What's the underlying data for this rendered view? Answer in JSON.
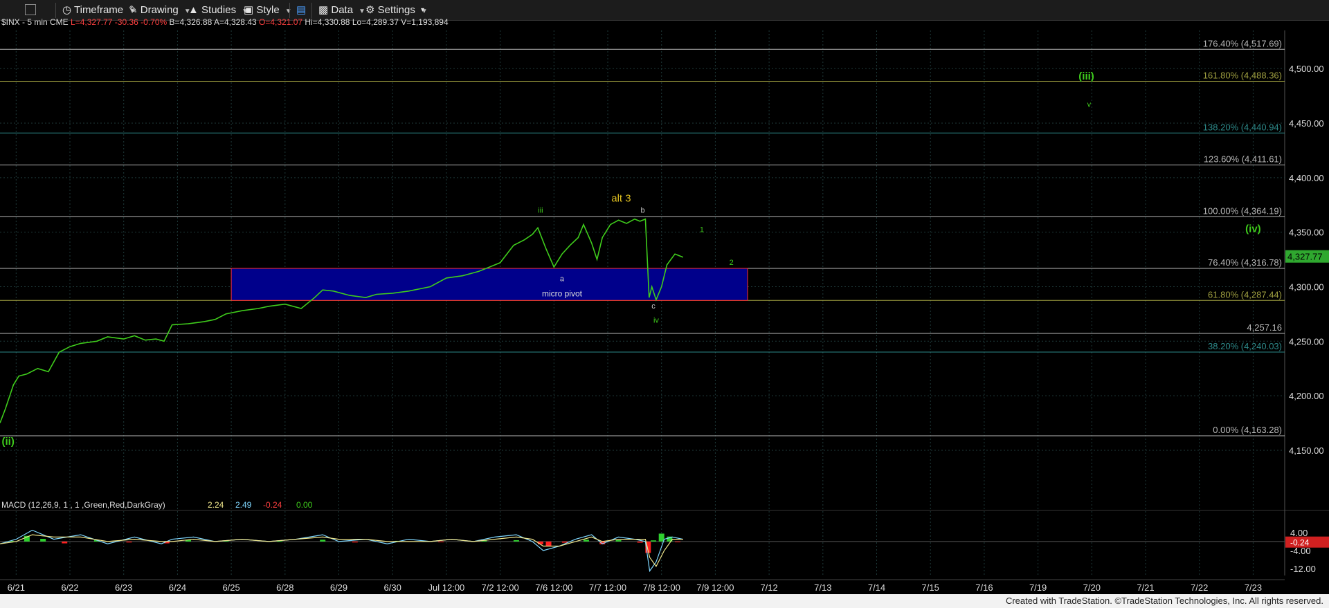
{
  "toolbar": {
    "timeframe": "Timeframe",
    "drawing": "Drawing",
    "studies": "Studies",
    "style": "Style",
    "data": "Data",
    "settings": "Settings"
  },
  "header": {
    "symbol": "$INX - 5 min  CME",
    "last": "L=4,327.77",
    "change": "-30.36",
    "change_pct": "-0.70%",
    "bid": "B=4,326.88",
    "ask": "A=4,328.43",
    "open": "O=4,321.07",
    "high": "Hi=4,330.88",
    "low": "Lo=4,289.37",
    "volume": "V=1,193,894"
  },
  "colors": {
    "price": "#3fcc1c",
    "grid": "#1f3a3a",
    "box_fill": "#00008b",
    "box_border": "#ff3030",
    "fib_gray": "#b8b8b8",
    "fib_olive": "#a0a040",
    "fib_teal": "#2d8a8a",
    "wave_green": "#3fcc1c",
    "alt_yellow": "#e0c020"
  },
  "chart_data": [
    {
      "type": "line",
      "title": "$INX - 5 min",
      "ylim": [
        4110,
        4535
      ],
      "y_ticks": [
        4150,
        4200,
        4250,
        4300,
        4350,
        4400,
        4450,
        4500
      ],
      "y_tick_labels": [
        "4,150.00",
        "4,200.00",
        "4,250.00",
        "4,300.00",
        "4,350.00",
        "4,400.00",
        "4,450.00",
        "4,500.00"
      ],
      "x_tick_labels": [
        "6/21",
        "6/22",
        "6/23",
        "6/24",
        "6/25",
        "6/28",
        "6/29",
        "6/30",
        "Jul 12:00",
        "7/2 12:00",
        "7/6 12:00",
        "7/7 12:00",
        "7/8 12:00",
        "7/9 12:00",
        "7/12",
        "7/13",
        "7/14",
        "7/15",
        "7/16",
        "7/19",
        "7/20",
        "7/21",
        "7/22",
        "7/23"
      ],
      "x_tick_index": [
        0.3,
        1.3,
        2.3,
        3.3,
        4.3,
        5.3,
        6.3,
        7.3,
        8.3,
        9.3,
        10.3,
        11.3,
        12.3,
        13.3,
        14.3,
        15.3,
        16.3,
        17.3,
        18.3,
        19.3,
        20.3,
        21.3,
        22.3,
        23.3
      ],
      "last_price": 4327.77,
      "last_price_label": "4,327.77",
      "series": [
        {
          "values_x": [
            0.0,
            0.1,
            0.25,
            0.35,
            0.5,
            0.7,
            0.9,
            1.1,
            1.3,
            1.5,
            1.8,
            2.0,
            2.3,
            2.5,
            2.7,
            2.9,
            3.05,
            3.2,
            3.5,
            3.8,
            4.0,
            4.2,
            4.5,
            4.8,
            5.0,
            5.3,
            5.6,
            5.85,
            6.0,
            6.2,
            6.5,
            6.8,
            7.0,
            7.3,
            7.6,
            8.0,
            8.3,
            8.6,
            8.9,
            9.1,
            9.3,
            9.55,
            9.75,
            9.9,
            10.0,
            10.15,
            10.3,
            10.45,
            10.6,
            10.75,
            10.85,
            11.0,
            11.1,
            11.2,
            11.35,
            11.5,
            11.65,
            11.8,
            11.9,
            12.0,
            12.07,
            12.12,
            12.2,
            12.3,
            12.4,
            12.55,
            12.7
          ],
          "values_y": [
            4175,
            4188,
            4210,
            4218,
            4220,
            4225,
            4222,
            4240,
            4245,
            4248,
            4250,
            4254,
            4252,
            4255,
            4251,
            4252,
            4250,
            4265,
            4266,
            4268,
            4270,
            4275,
            4278,
            4280,
            4282,
            4284,
            4280,
            4290,
            4297,
            4296,
            4292,
            4290,
            4293,
            4294,
            4296,
            4300,
            4308,
            4310,
            4314,
            4318,
            4322,
            4338,
            4343,
            4348,
            4354,
            4335,
            4318,
            4330,
            4338,
            4345,
            4357,
            4340,
            4325,
            4345,
            4357,
            4361,
            4358,
            4362,
            4360,
            4362,
            4290,
            4300,
            4288,
            4300,
            4320,
            4330,
            4327
          ]
        }
      ],
      "fib_levels": [
        {
          "label": "176.40% (4,517.69)",
          "value": 4517.69,
          "color": "#b8b8b8"
        },
        {
          "label": "161.80% (4,488.36)",
          "value": 4488.36,
          "color": "#a0a040"
        },
        {
          "label": "138.20% (4,440.94)",
          "value": 4440.94,
          "color": "#2d8a8a"
        },
        {
          "label": "123.60% (4,411.61)",
          "value": 4411.61,
          "color": "#b8b8b8"
        },
        {
          "label": "100.00% (4,364.19)",
          "value": 4364.19,
          "color": "#b8b8b8"
        },
        {
          "label": "76.40% (4,316.78)",
          "value": 4316.78,
          "color": "#b8b8b8"
        },
        {
          "label": "61.80% (4,287.44)",
          "value": 4287.44,
          "color": "#a0a040"
        },
        {
          "label": "4,257.16",
          "value": 4257.16,
          "color": "#b8b8b8"
        },
        {
          "label": "38.20% (4,240.03)",
          "value": 4240.03,
          "color": "#2d8a8a"
        },
        {
          "label": "0.00% (4,163.28)",
          "value": 4163.28,
          "color": "#b8b8b8"
        }
      ],
      "pivot_box": {
        "label": "micro pivot",
        "x0": 4.3,
        "x1": 13.9,
        "y0": 4287.44,
        "y1": 4316.78
      },
      "annotations": [
        {
          "text": "(ii)",
          "x": 0.15,
          "y": 4155,
          "color": "#3fcc1c"
        },
        {
          "text": "iii",
          "x": 10.05,
          "y": 4368,
          "color": "#3fcc1c"
        },
        {
          "text": "alt 3",
          "x": 11.55,
          "y": 4378,
          "color": "#e0c020"
        },
        {
          "text": "b",
          "x": 11.95,
          "y": 4368,
          "color": "#cccccc"
        },
        {
          "text": "a",
          "x": 10.45,
          "y": 4305,
          "color": "#cccccc"
        },
        {
          "text": "c",
          "x": 12.15,
          "y": 4280,
          "color": "#cccccc"
        },
        {
          "text": "iv",
          "x": 12.2,
          "y": 4267,
          "color": "#3fcc1c"
        },
        {
          "text": "1",
          "x": 13.05,
          "y": 4350,
          "color": "#3fcc1c"
        },
        {
          "text": "2",
          "x": 13.6,
          "y": 4320,
          "color": "#3fcc1c"
        },
        {
          "text": "(iii)",
          "x": 20.2,
          "y": 4490,
          "color": "#3fcc1c"
        },
        {
          "text": "v",
          "x": 20.25,
          "y": 4465,
          "color": "#3fcc1c"
        },
        {
          "text": "(iv)",
          "x": 23.3,
          "y": 4350,
          "color": "#3fcc1c"
        }
      ]
    },
    {
      "type": "line",
      "title": "MACD (12,26,9, 1 , 1 ,Green,Red,DarkGray)",
      "legend": [
        "2.24",
        "2.49",
        "-0.24",
        "0.00"
      ],
      "ylim": [
        -15,
        7
      ],
      "y_ticks": [
        4,
        -4,
        -12
      ],
      "y_tick_labels": [
        "4.00",
        "-4.00",
        "-12.00"
      ],
      "current_label": "-0.24",
      "series": [
        {
          "name": "MACD",
          "values_x": [
            0.0,
            0.3,
            0.6,
            1.0,
            1.5,
            2.0,
            2.5,
            3.0,
            3.2,
            3.6,
            4.0,
            4.5,
            5.0,
            5.5,
            6.0,
            6.3,
            6.8,
            7.2,
            7.6,
            8.0,
            8.4,
            8.8,
            9.2,
            9.6,
            9.9,
            10.1,
            10.4,
            10.7,
            11.0,
            11.2,
            11.5,
            11.8,
            12.0,
            12.08,
            12.2,
            12.35,
            12.5,
            12.7
          ],
          "values_y": [
            -1,
            1,
            5,
            1,
            3,
            -1,
            2,
            -1,
            1,
            2,
            0,
            1,
            0,
            1,
            3,
            0,
            1,
            -1,
            1,
            0,
            1,
            0,
            2,
            3,
            0,
            -4,
            -2,
            1,
            3,
            -1,
            2,
            1,
            0,
            -13,
            -9,
            1,
            2,
            1
          ]
        },
        {
          "name": "Signal",
          "values_x": [
            0.0,
            0.3,
            0.6,
            1.0,
            1.5,
            2.0,
            2.5,
            3.0,
            3.2,
            3.6,
            4.0,
            4.5,
            5.0,
            5.5,
            6.0,
            6.3,
            6.8,
            7.2,
            7.6,
            8.0,
            8.4,
            8.8,
            9.2,
            9.6,
            9.9,
            10.1,
            10.4,
            10.7,
            11.0,
            11.2,
            11.5,
            11.8,
            12.0,
            12.08,
            12.2,
            12.35,
            12.5,
            12.7
          ],
          "values_y": [
            -1,
            0,
            3,
            2,
            2,
            0,
            1,
            0,
            0,
            1,
            0,
            1,
            0,
            1,
            2,
            1,
            1,
            0,
            0,
            0,
            1,
            0,
            1,
            2,
            1,
            -2,
            -2,
            0,
            2,
            0,
            1,
            1,
            1,
            -7,
            -11,
            -4,
            1,
            1
          ]
        }
      ],
      "histogram_x": [
        0.2,
        0.5,
        0.8,
        1.2,
        1.8,
        2.4,
        3.1,
        3.5,
        4.2,
        5.2,
        6.0,
        6.6,
        7.4,
        8.2,
        9.0,
        9.6,
        10.05,
        10.2,
        10.5,
        10.9,
        11.2,
        11.5,
        11.9,
        12.05,
        12.15,
        12.3,
        12.45,
        12.6
      ],
      "histogram_y": [
        0.3,
        2.5,
        1.2,
        -0.8,
        0.6,
        -0.4,
        -0.8,
        0.8,
        0.4,
        0.2,
        0.8,
        -0.4,
        0.3,
        -0.3,
        0.5,
        0.6,
        -1.2,
        -2.2,
        -0.5,
        0.8,
        -1.2,
        0.6,
        -0.5,
        -5,
        0.5,
        3.5,
        2.2,
        -0.24
      ]
    }
  ],
  "footer": {
    "credit": "Created with TradeStation. ©TradeStation Technologies, Inc. All rights reserved."
  }
}
